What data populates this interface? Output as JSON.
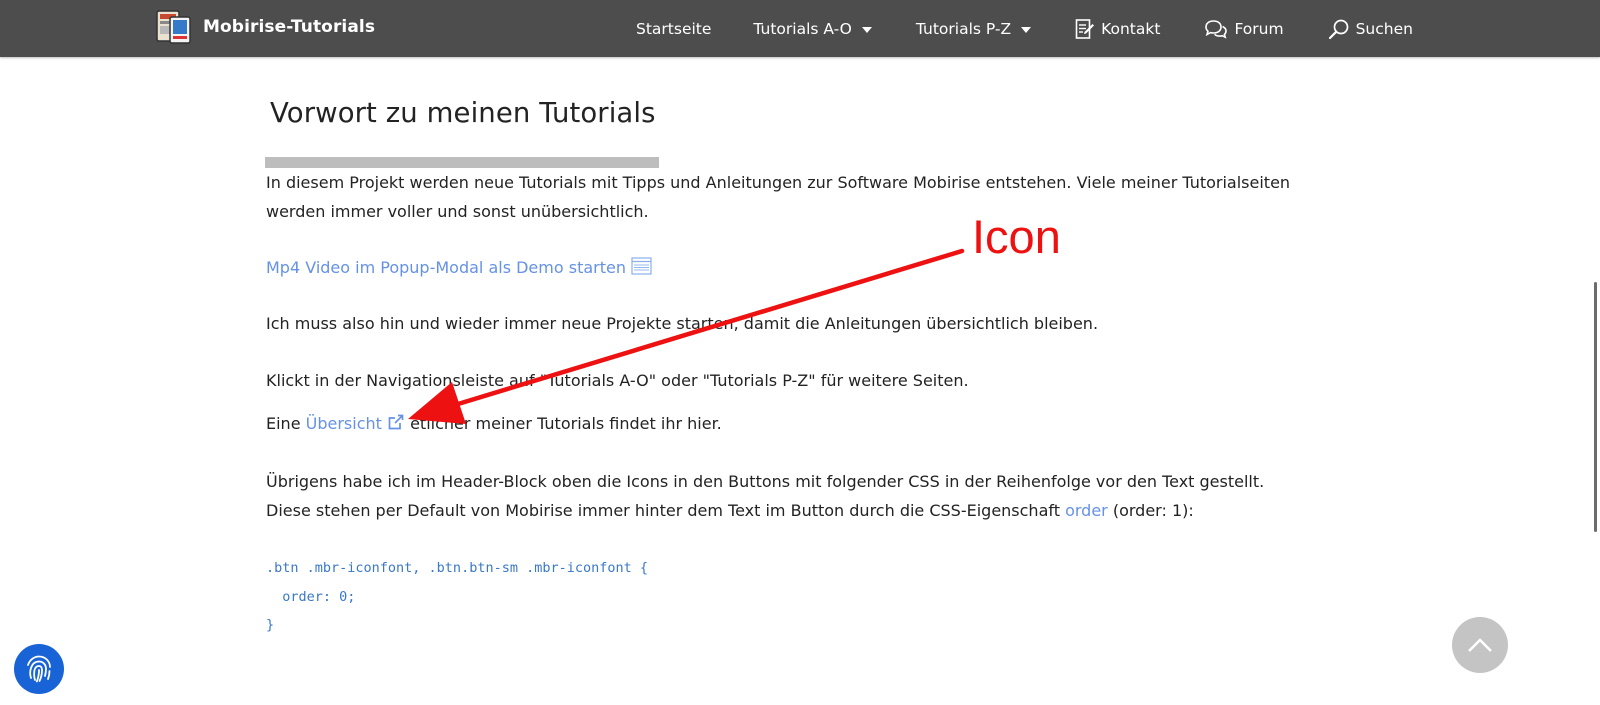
{
  "navbar": {
    "brand": "Mobirise-Tutorials",
    "items": [
      {
        "label": "Startseite",
        "icon": "",
        "dropdown": false
      },
      {
        "label": "Tutorials A-O",
        "icon": "",
        "dropdown": true
      },
      {
        "label": "Tutorials P-Z",
        "icon": "",
        "dropdown": true
      },
      {
        "label": "Kontakt",
        "icon": "edit-icon",
        "dropdown": false
      },
      {
        "label": "Forum",
        "icon": "chat-bubbles-icon",
        "dropdown": false
      },
      {
        "label": "Suchen",
        "icon": "search-icon",
        "dropdown": false
      }
    ]
  },
  "content": {
    "heading": "Vorwort zu meinen Tutorials",
    "p1_line1": "In diesem Projekt werden neue Tutorials mit Tipps und Anleitungen zur Software Mobirise entstehen. Viele meiner Tutorialseiten",
    "p1_line2": "werden immer voller und sonst unübersichtlich.",
    "video_link": "Mp4 Video im Popup-Modal als Demo starten",
    "p2": "Ich muss also hin und wieder immer neue Projekte starten, damit die Anleitungen übersichtlich bleiben.",
    "p3": "Klickt in der Navigationsleiste auf \"Tutorials A-O\" oder \"Tutorials P-Z\" für weitere Seiten.",
    "p4_before": "Eine ",
    "p4_link": "Übersicht",
    "p4_after": " etlicher meiner Tutorials findet ihr hier.",
    "p5_line1": "Übrigens habe ich im Header-Block oben die Icons in den Buttons mit folgender CSS in der Reihenfolge vor den Text gestellt.",
    "p5_line2_before": "Diese stehen per Default von Mobirise immer hinter dem Text im Button durch die CSS-Eigenschaft ",
    "p5_link": "order",
    "p5_line2_after": " (order: 1):",
    "code_line1": ".btn .mbr-iconfont, .btn.btn-sm .mbr-iconfont {",
    "code_line2": "  order: 0;",
    "code_line3": "}"
  },
  "annotation": {
    "label": "Icon",
    "color": "#ee1111"
  },
  "colors": {
    "navbar_bg": "#4d4d4d",
    "link": "#6592e6",
    "code": "#3a78c9",
    "fingerprint_bg": "#1864d6"
  }
}
